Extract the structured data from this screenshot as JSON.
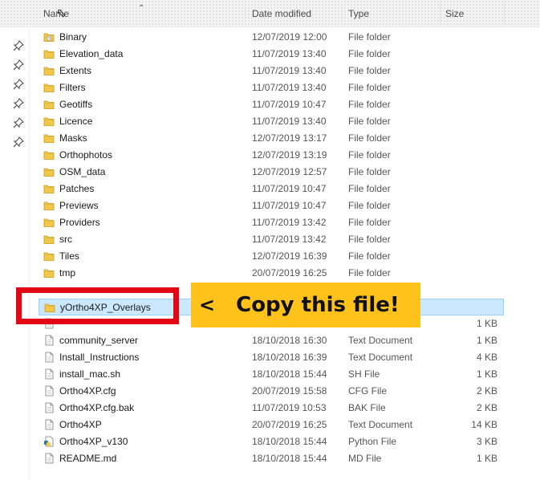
{
  "columns": {
    "name": "Name",
    "date_modified": "Date modified",
    "type": "Type",
    "size": "Size"
  },
  "quick_access": {
    "pins": [
      "pin-icon",
      "pin-icon",
      "pin-icon",
      "pin-icon",
      "pin-icon",
      "pin-icon"
    ]
  },
  "files": [
    {
      "name": "Binary",
      "date": "12/07/2019 12:00",
      "type": "File folder",
      "size": "",
      "icon": "binary-folder-icon"
    },
    {
      "name": "Elevation_data",
      "date": "11/07/2019 13:40",
      "type": "File folder",
      "size": "",
      "icon": "folder-icon"
    },
    {
      "name": "Extents",
      "date": "11/07/2019 13:40",
      "type": "File folder",
      "size": "",
      "icon": "folder-icon"
    },
    {
      "name": "Filters",
      "date": "11/07/2019 13:40",
      "type": "File folder",
      "size": "",
      "icon": "folder-icon"
    },
    {
      "name": "Geotiffs",
      "date": "11/07/2019 10:47",
      "type": "File folder",
      "size": "",
      "icon": "folder-icon"
    },
    {
      "name": "Licence",
      "date": "11/07/2019 13:40",
      "type": "File folder",
      "size": "",
      "icon": "folder-icon"
    },
    {
      "name": "Masks",
      "date": "12/07/2019 13:17",
      "type": "File folder",
      "size": "",
      "icon": "folder-icon"
    },
    {
      "name": "Orthophotos",
      "date": "12/07/2019 13:19",
      "type": "File folder",
      "size": "",
      "icon": "folder-icon"
    },
    {
      "name": "OSM_data",
      "date": "12/07/2019 12:57",
      "type": "File folder",
      "size": "",
      "icon": "folder-icon"
    },
    {
      "name": "Patches",
      "date": "11/07/2019 10:47",
      "type": "File folder",
      "size": "",
      "icon": "folder-icon"
    },
    {
      "name": "Previews",
      "date": "11/07/2019 10:47",
      "type": "File folder",
      "size": "",
      "icon": "folder-icon"
    },
    {
      "name": "Providers",
      "date": "11/07/2019 13:42",
      "type": "File folder",
      "size": "",
      "icon": "folder-icon"
    },
    {
      "name": "src",
      "date": "11/07/2019 13:42",
      "type": "File folder",
      "size": "",
      "icon": "folder-icon"
    },
    {
      "name": "Tiles",
      "date": "12/07/2019 16:39",
      "type": "File folder",
      "size": "",
      "icon": "folder-icon"
    },
    {
      "name": "tmp",
      "date": "20/07/2019 16:25",
      "type": "File folder",
      "size": "",
      "icon": "folder-icon"
    }
  ],
  "selected_file": {
    "name": "yOrtho4XP_Overlays",
    "icon": "folder-icon"
  },
  "files_after": [
    {
      "name": "",
      "date": "",
      "type": "",
      "size": "1 KB",
      "icon": "document-icon"
    },
    {
      "name": "community_server",
      "date": "18/10/2018 16:30",
      "type": "Text Document",
      "size": "1 KB",
      "icon": "document-icon"
    },
    {
      "name": "Install_Instructions",
      "date": "18/10/2018 16:39",
      "type": "Text Document",
      "size": "4 KB",
      "icon": "document-icon"
    },
    {
      "name": "install_mac.sh",
      "date": "18/10/2018 15:44",
      "type": "SH File",
      "size": "1 KB",
      "icon": "document-icon"
    },
    {
      "name": "Ortho4XP.cfg",
      "date": "20/07/2019 15:58",
      "type": "CFG File",
      "size": "2 KB",
      "icon": "document-icon"
    },
    {
      "name": "Ortho4XP.cfg.bak",
      "date": "11/07/2019 10:53",
      "type": "BAK File",
      "size": "2 KB",
      "icon": "document-icon"
    },
    {
      "name": "Ortho4XP",
      "date": "20/07/2019 16:25",
      "type": "Text Document",
      "size": "14 KB",
      "icon": "document-icon"
    },
    {
      "name": "Ortho4XP_v130",
      "date": "18/10/2018 15:44",
      "type": "Python File",
      "size": "3 KB",
      "icon": "python-file-icon"
    },
    {
      "name": "README.md",
      "date": "18/10/2018 15:44",
      "type": "MD File",
      "size": "1 KB",
      "icon": "document-icon"
    }
  ],
  "callout": {
    "arrow": "<",
    "text": "Copy this file!"
  },
  "colors": {
    "selection": "#cce8ff",
    "highlight_box": "#e30613",
    "banner": "#ffc21b",
    "folder": "#f2c84b"
  }
}
